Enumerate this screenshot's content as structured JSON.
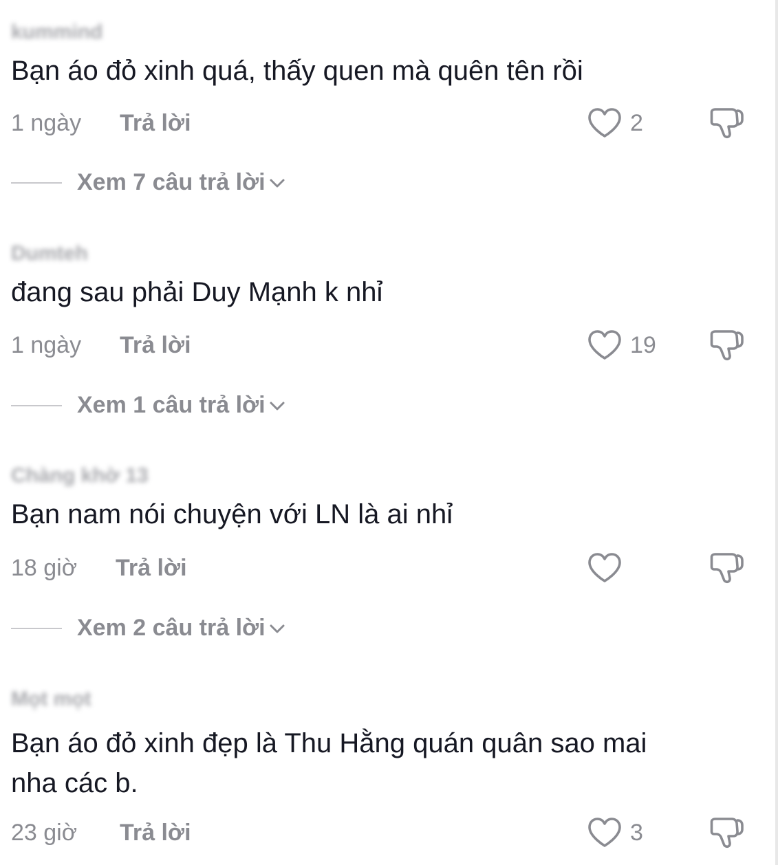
{
  "comments": [
    {
      "username": "kummind",
      "text": "Bạn áo đỏ xinh quá, thấy quen mà quên tên rồi",
      "time": "1 ngày",
      "reply_label": "Trả lời",
      "likes": "2",
      "view_replies": "Xem 7 câu trả lời"
    },
    {
      "username": "Dumteh",
      "text": "đang sau phải Duy Mạnh k nhỉ",
      "time": "1 ngày",
      "reply_label": "Trả lời",
      "likes": "19",
      "view_replies": "Xem 1 câu trả lời"
    },
    {
      "username": "Chàng khờ 13",
      "text": "Bạn nam nói chuyện với LN là ai nhỉ",
      "time": "18 giờ",
      "reply_label": "Trả lời",
      "likes": "",
      "view_replies": "Xem 2 câu trả lời"
    },
    {
      "username": "Mọt mọt",
      "text": "Bạn áo đỏ xinh đẹp là Thu Hằng quán quân sao mai nha các b.",
      "time": "23 giờ",
      "reply_label": "Trả lời",
      "likes": "3"
    }
  ],
  "icons": {
    "like": "heart-outline-icon",
    "dislike": "thumbs-down-outline-icon",
    "expand": "chevron-down-icon"
  },
  "colors": {
    "text": "#161823",
    "secondary": "#8a8b91",
    "icon": "#8a8b91"
  }
}
